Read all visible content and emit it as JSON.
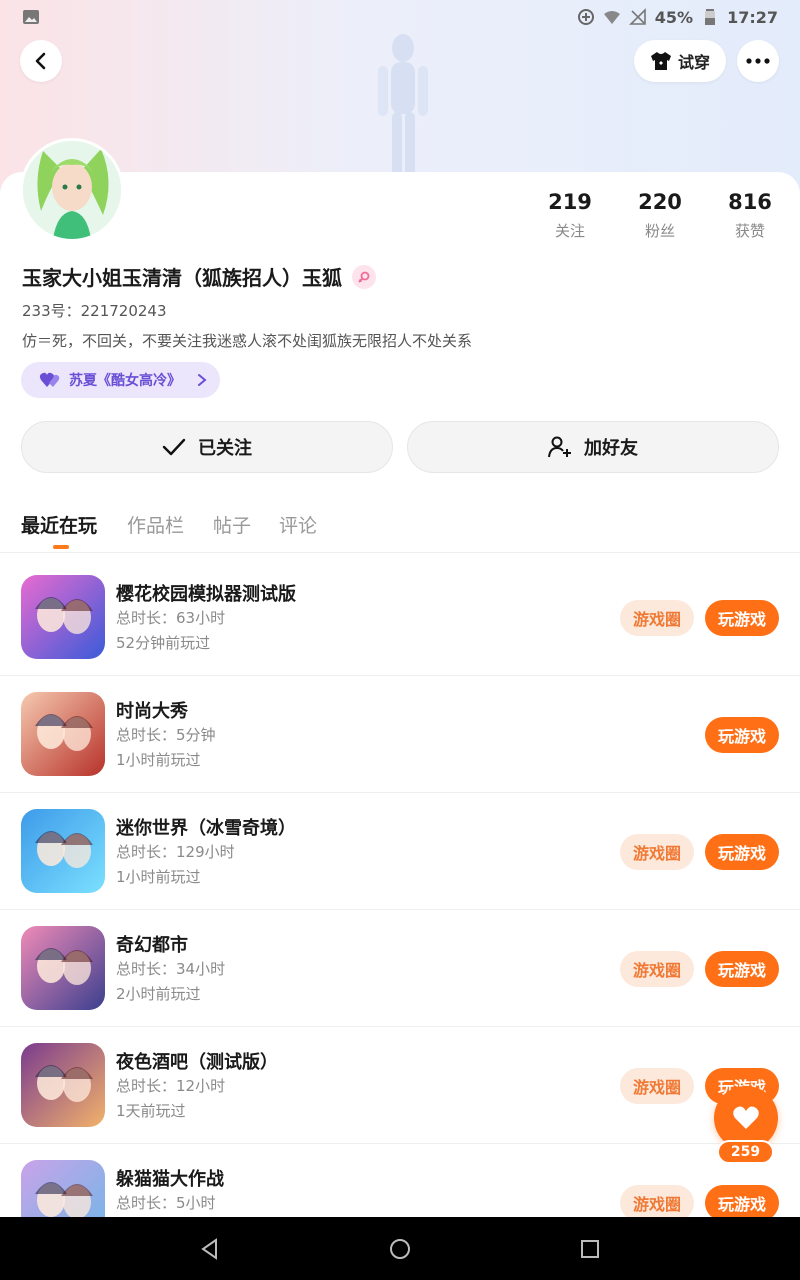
{
  "status_bar": {
    "battery": "45%",
    "time": "17:27"
  },
  "header": {
    "tryon_label": "试穿"
  },
  "profile": {
    "name": "玉家大小姐玉清清（狐族招人）玉狐",
    "uid": "233号：221720243",
    "bio": "仿＝死，不回关，不要关注我迷惑人滚不处闺狐族无限招人不处关系",
    "cp_tag": "苏夏《酷女高冷》",
    "stats": [
      {
        "num": "219",
        "label": "关注"
      },
      {
        "num": "220",
        "label": "粉丝"
      },
      {
        "num": "816",
        "label": "获赞"
      }
    ],
    "followed_label": "已关注",
    "add_friend_label": "加好友"
  },
  "tabs": [
    "最近在玩",
    "作品栏",
    "帖子",
    "评论"
  ],
  "game_circle_label": "游戏圈",
  "play_label": "玩游戏",
  "games": [
    {
      "title": "樱花校园模拟器测试版",
      "duration": "总时长：63小时",
      "last": "52分钟前玩过",
      "has_circle": true,
      "colors": [
        "#e86bd0",
        "#3a5bd9"
      ]
    },
    {
      "title": "时尚大秀",
      "duration": "总时长：5分钟",
      "last": "1小时前玩过",
      "has_circle": false,
      "colors": [
        "#f6c9b0",
        "#b7322a"
      ]
    },
    {
      "title": "迷你世界（冰雪奇境）",
      "duration": "总时长：129小时",
      "last": "1小时前玩过",
      "has_circle": true,
      "colors": [
        "#3d9be9",
        "#7be0ff"
      ]
    },
    {
      "title": "奇幻都市",
      "duration": "总时长：34小时",
      "last": "2小时前玩过",
      "has_circle": true,
      "colors": [
        "#f08bb7",
        "#3b3f8f"
      ]
    },
    {
      "title": "夜色酒吧（测试版）",
      "duration": "总时长：12小时",
      "last": "1天前玩过",
      "has_circle": true,
      "colors": [
        "#7a3b8f",
        "#f2b26a"
      ]
    },
    {
      "title": "躲猫猫大作战",
      "duration": "总时长：5小时",
      "last": "",
      "has_circle": true,
      "colors": [
        "#c9a3e8",
        "#6fb7e8"
      ]
    }
  ],
  "like_count": "259"
}
